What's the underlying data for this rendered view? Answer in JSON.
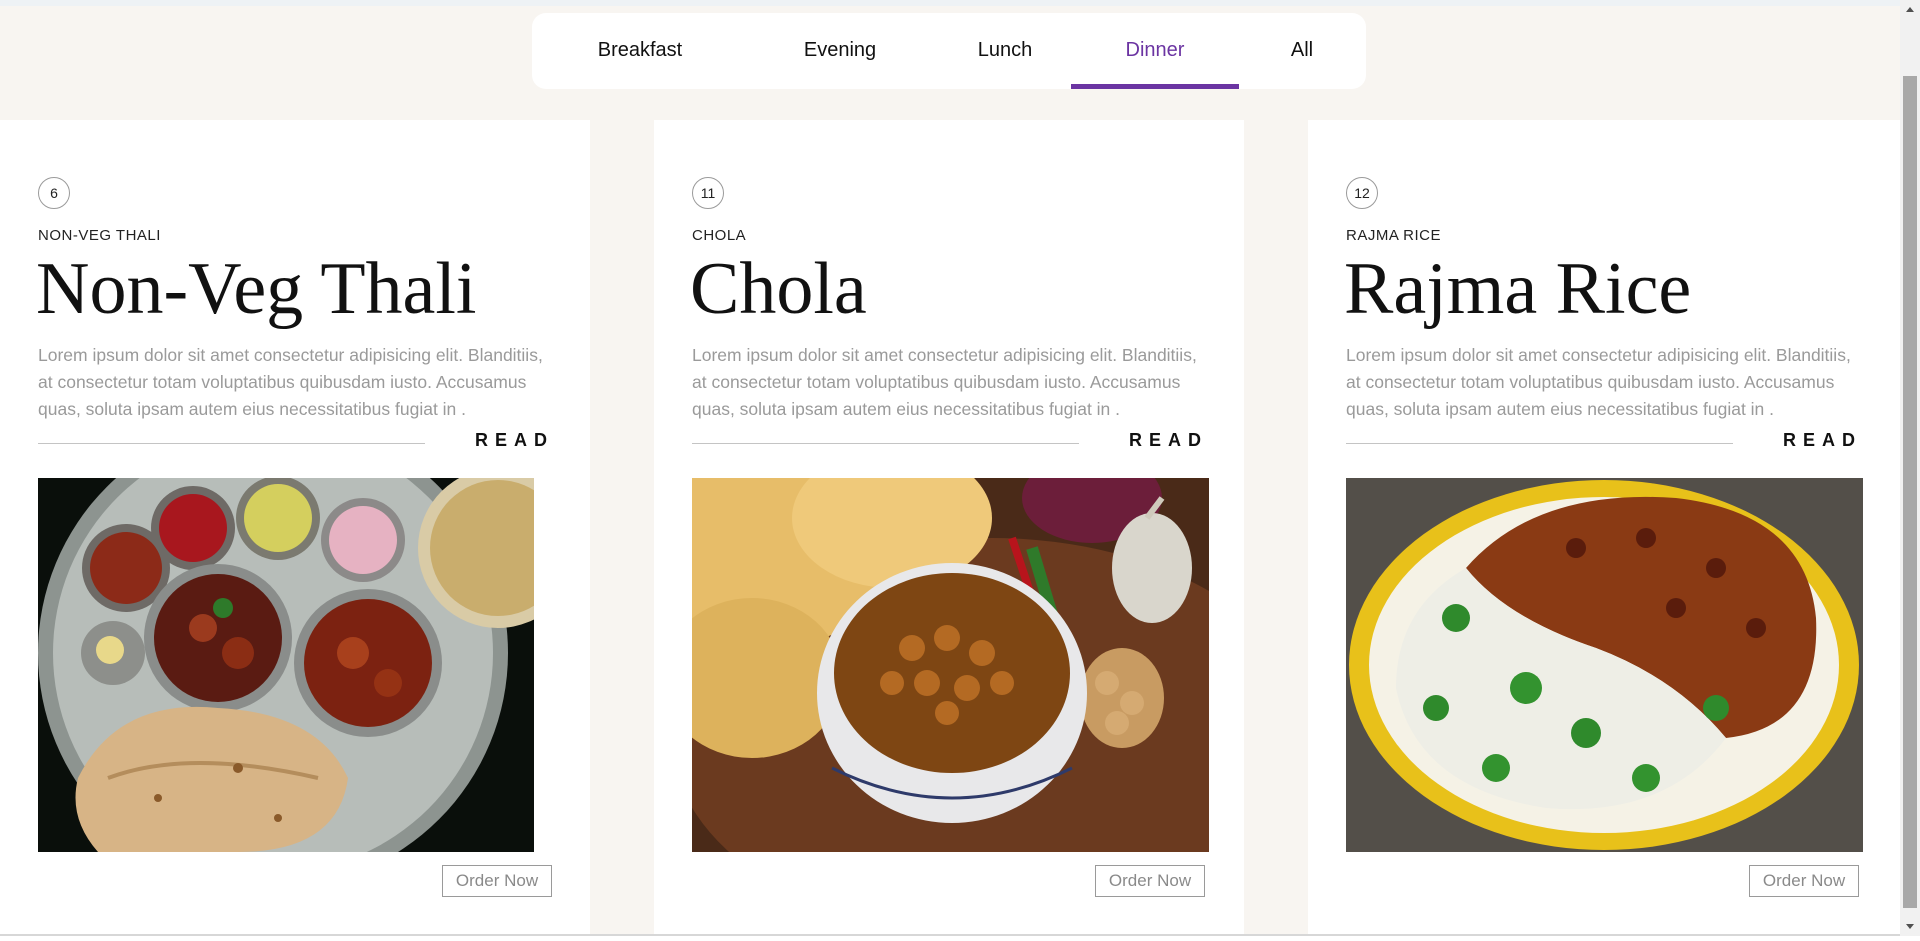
{
  "tabs": [
    {
      "label": "Breakfast"
    },
    {
      "label": "Evening"
    },
    {
      "label": "Lunch"
    },
    {
      "label": "Dinner",
      "active": true
    },
    {
      "label": "All"
    }
  ],
  "colors": {
    "accent": "#6b34a2",
    "band": "#f8f5f1",
    "muted_text": "#9a9a9a"
  },
  "cards": [
    {
      "number": "6",
      "subtitle": "NON-VEG THALI",
      "title": "Non-Veg Thali",
      "description": "Lorem ipsum dolor sit amet consectetur adipisicing elit. Blanditiis, at consectetur totam voluptatibus quibusdam iusto. Accusamus quas, soluta ipsam autem eius necessitatibus fugiat in .",
      "read_label": "READ",
      "button_label": "Order Now"
    },
    {
      "number": "11",
      "subtitle": "CHOLA",
      "title": "Chola",
      "description": "Lorem ipsum dolor sit amet consectetur adipisicing elit. Blanditiis, at consectetur totam voluptatibus quibusdam iusto. Accusamus quas, soluta ipsam autem eius necessitatibus fugiat in .",
      "read_label": "READ",
      "button_label": "Order Now"
    },
    {
      "number": "12",
      "subtitle": "RAJMA RICE",
      "title": "Rajma Rice",
      "description": "Lorem ipsum dolor sit amet consectetur adipisicing elit. Blanditiis, at consectetur totam voluptatibus quibusdam iusto. Accusamus quas, soluta ipsam autem eius necessitatibus fugiat in .",
      "read_label": "READ",
      "button_label": "Order Now"
    }
  ]
}
